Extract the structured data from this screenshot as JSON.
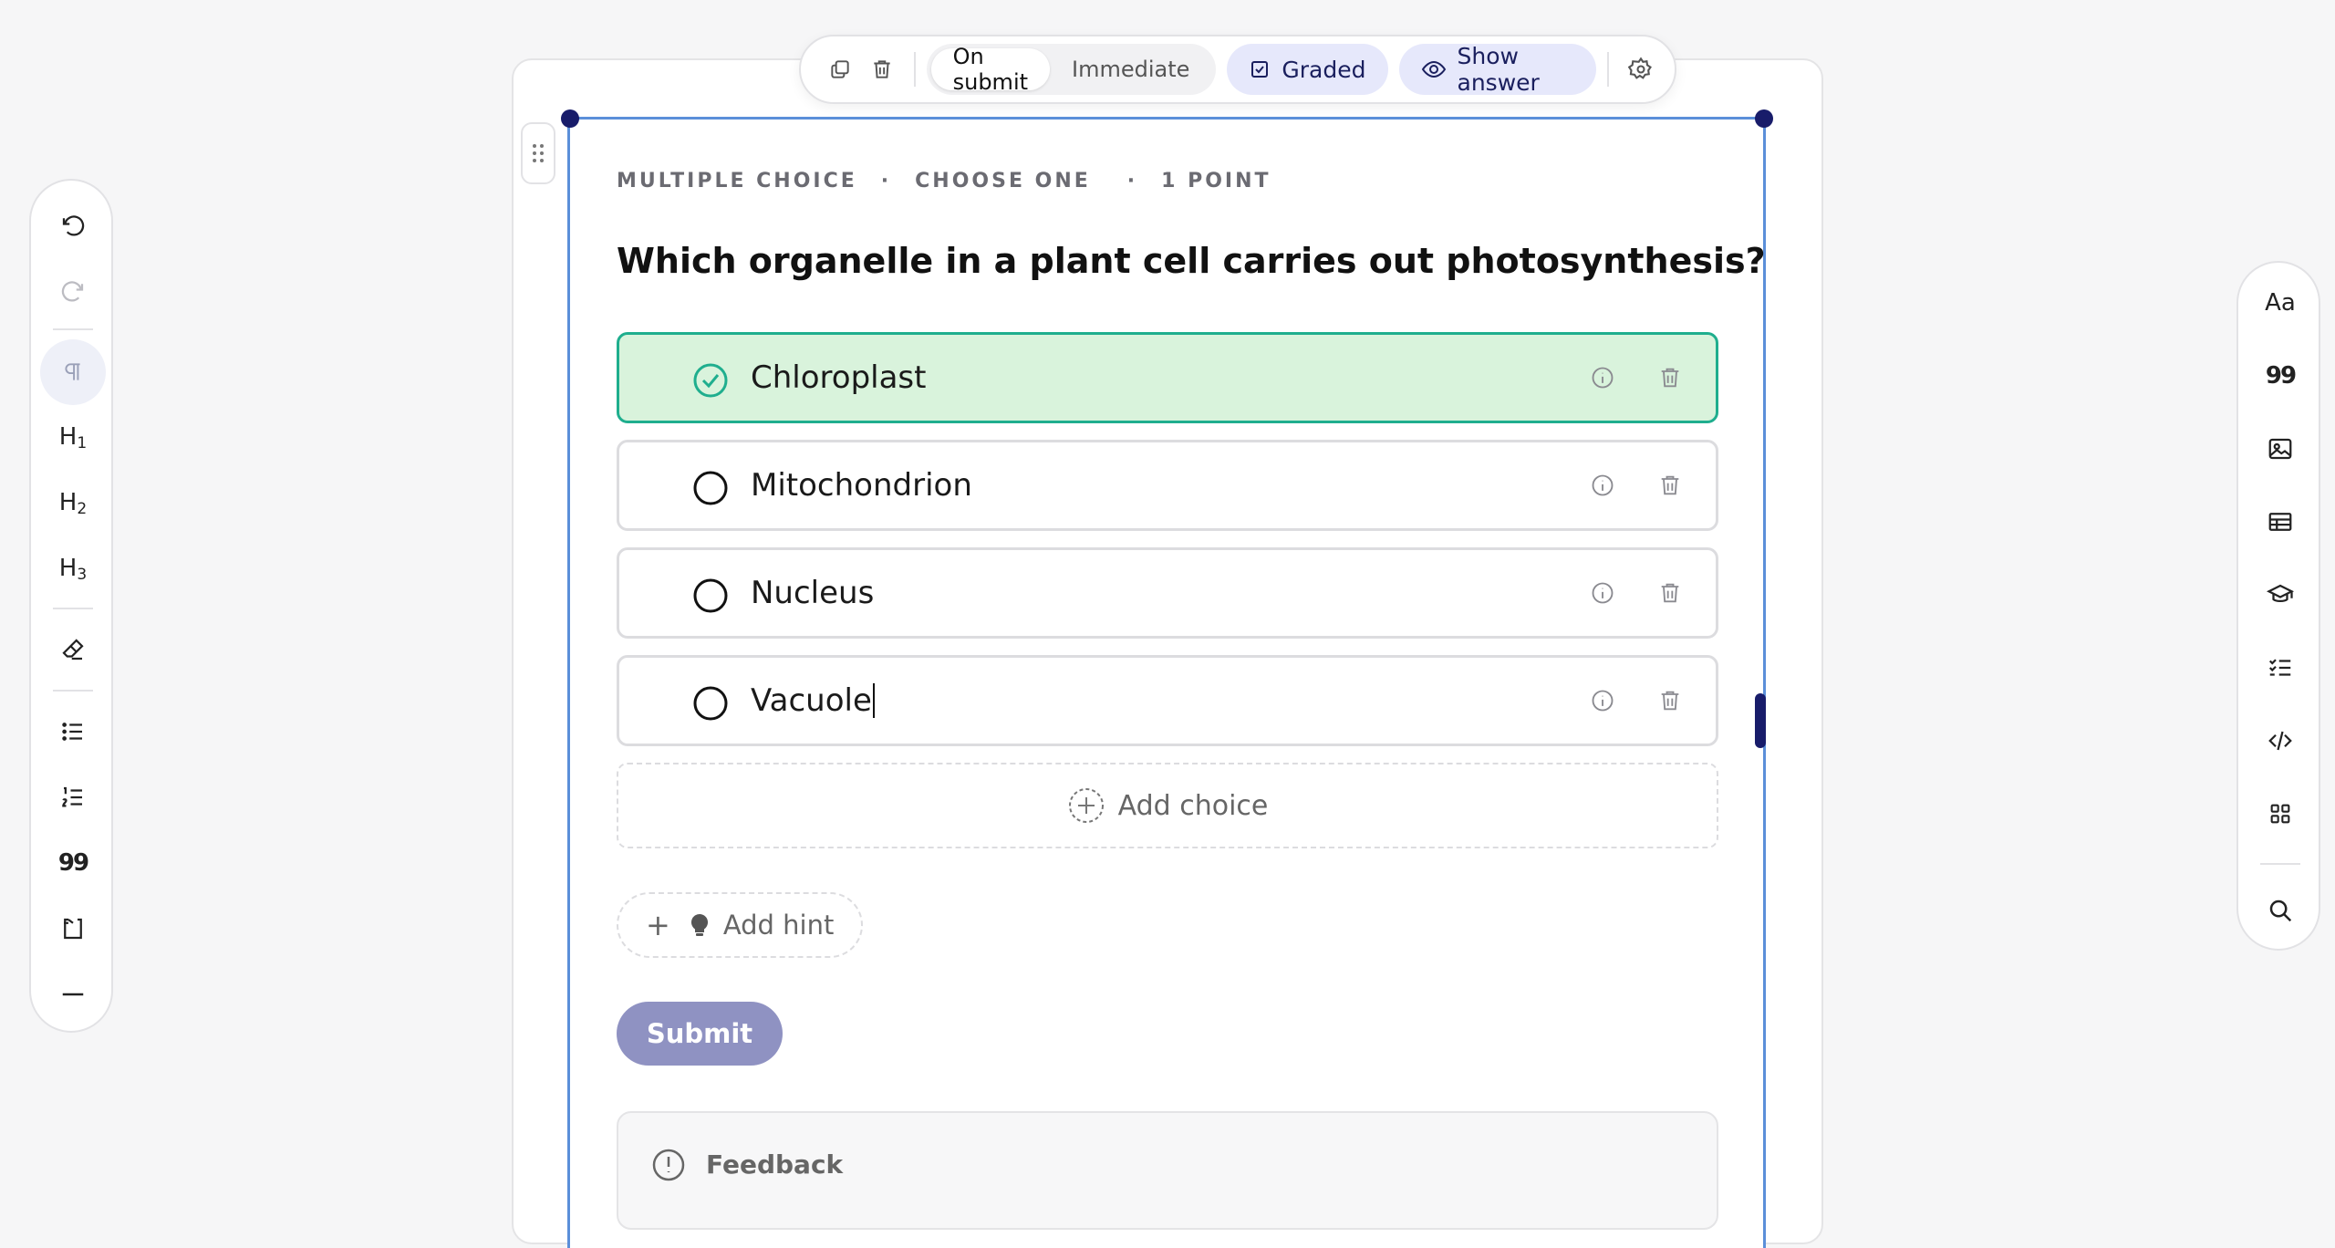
{
  "toolbar": {
    "on_submit": "On submit",
    "immediate": "Immediate",
    "graded": "Graded",
    "show_answer": "Show answer"
  },
  "question": {
    "type": "MULTIPLE CHOICE",
    "mode": "CHOOSE ONE",
    "points": "1 POINT",
    "separator": "·",
    "text": "Which organelle in a plant cell carries out photosynthesis?",
    "choices": [
      {
        "label": "Chloroplast",
        "correct": true
      },
      {
        "label": "Mitochondrion",
        "correct": false
      },
      {
        "label": "Nucleus",
        "correct": false
      },
      {
        "label": "Vacuole",
        "correct": false
      }
    ],
    "add_choice": "Add choice",
    "add_hint": "Add hint",
    "add_hint_plus": "+",
    "submit": "Submit",
    "feedback": "Feedback"
  },
  "left_rail": {
    "h1": "H",
    "h1_sub": "1",
    "h2": "H",
    "h2_sub": "2",
    "h3": "H",
    "h3_sub": "3",
    "quote_glyph": "99"
  },
  "right_rail": {
    "text_style": "Aa",
    "quote_glyph": "99"
  },
  "colors": {
    "accent": "#181c6a",
    "selection": "#5b8fd9",
    "correct_bg": "#d9f3dc",
    "correct_border": "#1fae8e",
    "submit": "#8f92c2"
  },
  "icons": {
    "toolbar": [
      "duplicate-icon",
      "trash-icon",
      "checkbox-icon",
      "eye-icon",
      "gear-icon"
    ],
    "left_rail": [
      "undo-icon",
      "redo-icon",
      "paragraph-icon",
      "eraser-icon",
      "bullet-list-icon",
      "numbered-list-icon",
      "quote-icon",
      "code-block-icon",
      "horizontal-rule-icon"
    ],
    "right_rail": [
      "text-style-icon",
      "quote-icon",
      "image-icon",
      "table-icon",
      "graduation-cap-icon",
      "checklist-icon",
      "code-icon",
      "grid-icon",
      "search-icon"
    ]
  }
}
